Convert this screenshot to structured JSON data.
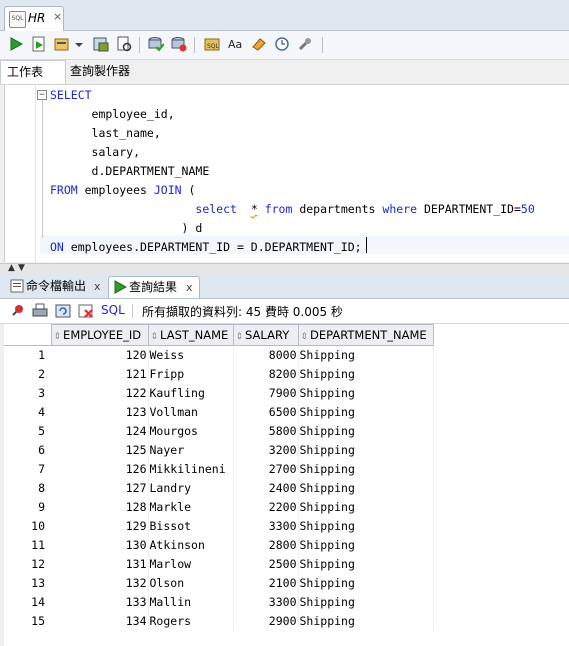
{
  "document_tab": {
    "label": "HR",
    "close": "×"
  },
  "editor_tabs": {
    "worksheet": "工作表",
    "query_builder": "查詢製作器"
  },
  "editor": {
    "fold_marker": "−",
    "lines": [
      [
        {
          "t": "SELECT",
          "k": true
        }
      ],
      [
        {
          "t": "      employee_id,"
        }
      ],
      [
        {
          "t": "      last_name,"
        }
      ],
      [
        {
          "t": "      salary,"
        }
      ],
      [
        {
          "t": "      d.DEPARTMENT_NAME"
        }
      ],
      [
        {
          "t": "FROM",
          "k": true
        },
        {
          "t": " employees "
        },
        {
          "t": "JOIN",
          "k": true
        },
        {
          "t": " ("
        }
      ],
      [
        {
          "t": "                     "
        },
        {
          "t": "select",
          "k": true
        },
        {
          "t": "  "
        },
        {
          "t": "*",
          "w": true
        },
        {
          "t": " "
        },
        {
          "t": "from",
          "k": true
        },
        {
          "t": " departments "
        },
        {
          "t": "where",
          "k": true
        },
        {
          "t": " DEPARTMENT_ID="
        },
        {
          "t": "50",
          "n": true
        }
      ],
      [
        {
          "t": "                   ) d"
        }
      ],
      [
        {
          "t": "ON",
          "k": true
        },
        {
          "t": " employees.DEPARTMENT_ID = D.DEPARTMENT_ID;"
        }
      ]
    ]
  },
  "result_tabs": {
    "script_output": "命令檔輸出",
    "query_result": "查詢結果",
    "close": "x"
  },
  "results_toolbar": {
    "sql_label": "SQL",
    "status": "所有擷取的資料列: 45 費時 0.005 秒"
  },
  "grid": {
    "columns": [
      "EMPLOYEE_ID",
      "LAST_NAME",
      "SALARY",
      "DEPARTMENT_NAME"
    ],
    "rows": [
      [
        "1",
        "120",
        "Weiss",
        "8000",
        "Shipping"
      ],
      [
        "2",
        "121",
        "Fripp",
        "8200",
        "Shipping"
      ],
      [
        "3",
        "122",
        "Kaufling",
        "7900",
        "Shipping"
      ],
      [
        "4",
        "123",
        "Vollman",
        "6500",
        "Shipping"
      ],
      [
        "5",
        "124",
        "Mourgos",
        "5800",
        "Shipping"
      ],
      [
        "6",
        "125",
        "Nayer",
        "3200",
        "Shipping"
      ],
      [
        "7",
        "126",
        "Mikkilineni",
        "2700",
        "Shipping"
      ],
      [
        "8",
        "127",
        "Landry",
        "2400",
        "Shipping"
      ],
      [
        "9",
        "128",
        "Markle",
        "2200",
        "Shipping"
      ],
      [
        "10",
        "129",
        "Bissot",
        "3300",
        "Shipping"
      ],
      [
        "11",
        "130",
        "Atkinson",
        "2800",
        "Shipping"
      ],
      [
        "12",
        "131",
        "Marlow",
        "2500",
        "Shipping"
      ],
      [
        "13",
        "132",
        "Olson",
        "2100",
        "Shipping"
      ],
      [
        "14",
        "133",
        "Mallin",
        "3300",
        "Shipping"
      ],
      [
        "15",
        "134",
        "Rogers",
        "2900",
        "Shipping"
      ]
    ]
  },
  "colors": {
    "keyword": "#1a27d6",
    "accent_green": "#2e9b2e"
  }
}
